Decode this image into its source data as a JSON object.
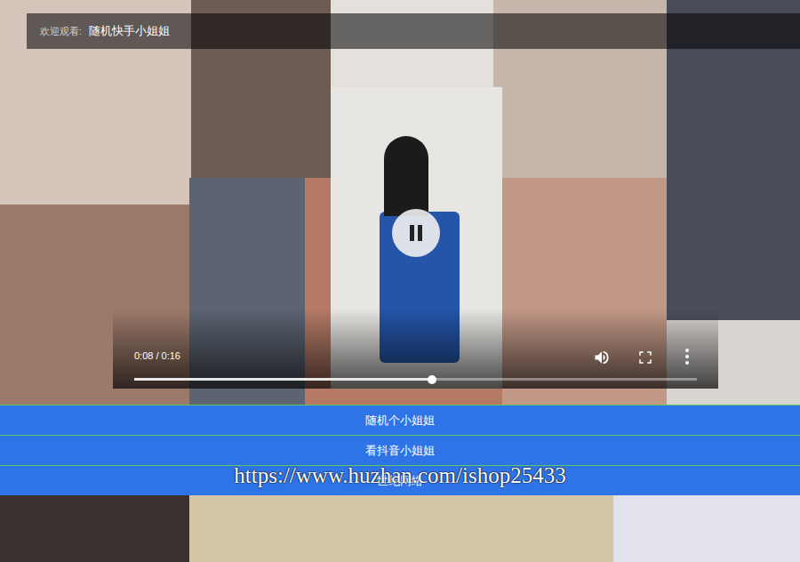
{
  "header": {
    "label": "欢迎观看:",
    "title": "随机快手小姐姐"
  },
  "player": {
    "playing": true,
    "time": "0:08 / 0:16",
    "level": 0.53
  },
  "buttons": [
    "随机个小姐姐",
    "看抖音小姐姐",
    "世纪网络"
  ],
  "watermark": "https://www.huzhan.com/ishop25433"
}
